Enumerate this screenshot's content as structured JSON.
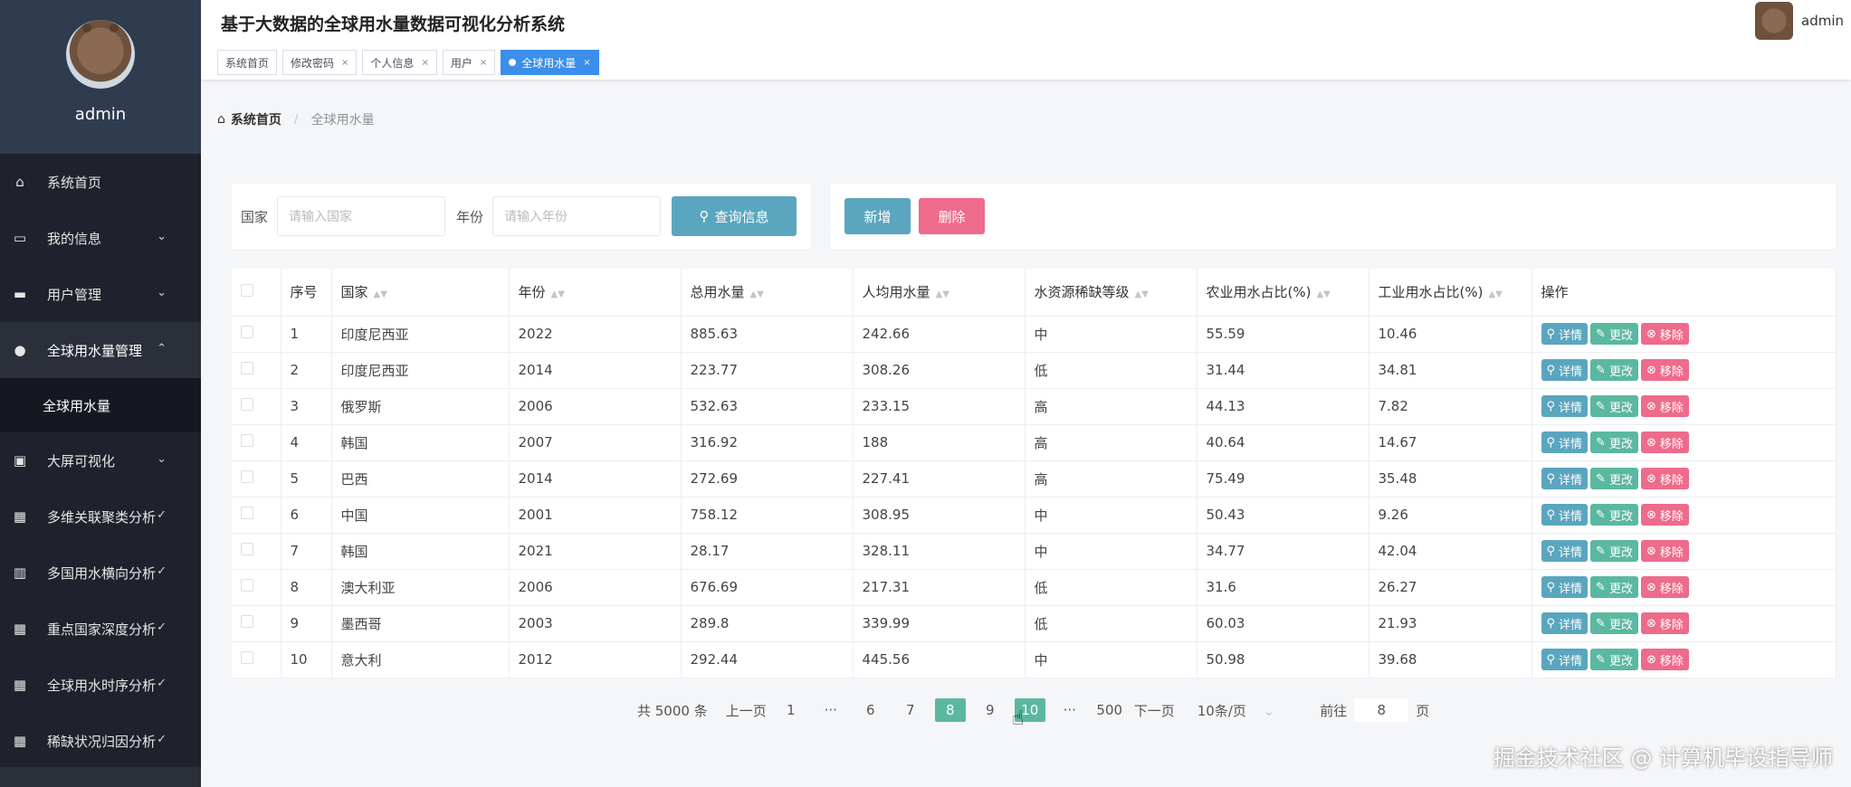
{
  "sidebar": {
    "username": "admin",
    "items": [
      {
        "label": "系统首页",
        "icon": "home-icon",
        "chevron": ""
      },
      {
        "label": "我的信息",
        "icon": "card-icon",
        "chevron": "⌄"
      },
      {
        "label": "用户管理",
        "icon": "user-group-icon",
        "chevron": "⌄"
      },
      {
        "label": "全球用水量管理",
        "icon": "person-icon",
        "chevron": "⌃"
      },
      {
        "label": "大屏可视化",
        "icon": "clipboard-icon",
        "chevron": "⌄"
      },
      {
        "label": "多维关联聚类分析",
        "icon": "grid-icon",
        "chevron": "✓"
      },
      {
        "label": "多国用水横向分析",
        "icon": "book-icon",
        "chevron": "✓"
      },
      {
        "label": "重点国家深度分析",
        "icon": "grid-icon",
        "chevron": "✓"
      },
      {
        "label": "全球用水时序分析",
        "icon": "grid-icon",
        "chevron": "✓"
      },
      {
        "label": "稀缺状况归因分析",
        "icon": "grid-icon",
        "chevron": "✓"
      }
    ],
    "submenu_label": "全球用水量"
  },
  "header": {
    "title": "基于大数据的全球用水量数据可视化分析系统",
    "username": "admin",
    "tabs": [
      {
        "label": "系统首页",
        "closable": false
      },
      {
        "label": "修改密码",
        "closable": true
      },
      {
        "label": "个人信息",
        "closable": true
      },
      {
        "label": "用户",
        "closable": true
      },
      {
        "label": "全球用水量",
        "closable": true,
        "active": true
      }
    ],
    "close_glyph": "×"
  },
  "breadcrumb": {
    "home": "系统首页",
    "separator": "/",
    "current": "全球用水量"
  },
  "search": {
    "country_label": "国家",
    "country_placeholder": "请输入国家",
    "year_label": "年份",
    "year_placeholder": "请输入年份",
    "query_button": "查询信息"
  },
  "actions": {
    "add": "新增",
    "delete": "删除"
  },
  "table": {
    "columns": [
      "序号",
      "国家",
      "年份",
      "总用水量",
      "人均用水量",
      "水资源稀缺等级",
      "农业用水占比(%)",
      "工业用水占比(%)",
      "操作"
    ],
    "op_labels": {
      "detail": "详情",
      "edit": "更改",
      "remove": "移除"
    },
    "rows": [
      [
        "1",
        "印度尼西亚",
        "2022",
        "885.63",
        "242.66",
        "中",
        "55.59",
        "10.46"
      ],
      [
        "2",
        "印度尼西亚",
        "2014",
        "223.77",
        "308.26",
        "低",
        "31.44",
        "34.81"
      ],
      [
        "3",
        "俄罗斯",
        "2006",
        "532.63",
        "233.15",
        "高",
        "44.13",
        "7.82"
      ],
      [
        "4",
        "韩国",
        "2007",
        "316.92",
        "188",
        "高",
        "40.64",
        "14.67"
      ],
      [
        "5",
        "巴西",
        "2014",
        "272.69",
        "227.41",
        "高",
        "75.49",
        "35.48"
      ],
      [
        "6",
        "中国",
        "2001",
        "758.12",
        "308.95",
        "中",
        "50.43",
        "9.26"
      ],
      [
        "7",
        "韩国",
        "2021",
        "28.17",
        "328.11",
        "中",
        "34.77",
        "42.04"
      ],
      [
        "8",
        "澳大利亚",
        "2006",
        "676.69",
        "217.31",
        "低",
        "31.6",
        "26.27"
      ],
      [
        "9",
        "墨西哥",
        "2003",
        "289.8",
        "339.99",
        "低",
        "60.03",
        "21.93"
      ],
      [
        "10",
        "意大利",
        "2012",
        "292.44",
        "445.56",
        "中",
        "50.98",
        "39.68"
      ]
    ]
  },
  "pagination": {
    "total": "共 5000 条",
    "prev": "上一页",
    "pages": [
      "1",
      "···",
      "6",
      "7",
      "8",
      "9",
      "10",
      "···",
      "500"
    ],
    "current_page": "8",
    "hover_page": "10",
    "next": "下一页",
    "page_size": "10条/页",
    "goto_prefix": "前往",
    "goto_value": "8",
    "goto_suffix": "页"
  },
  "watermark": "掘金技术社区 @ 计算机毕设指导师"
}
